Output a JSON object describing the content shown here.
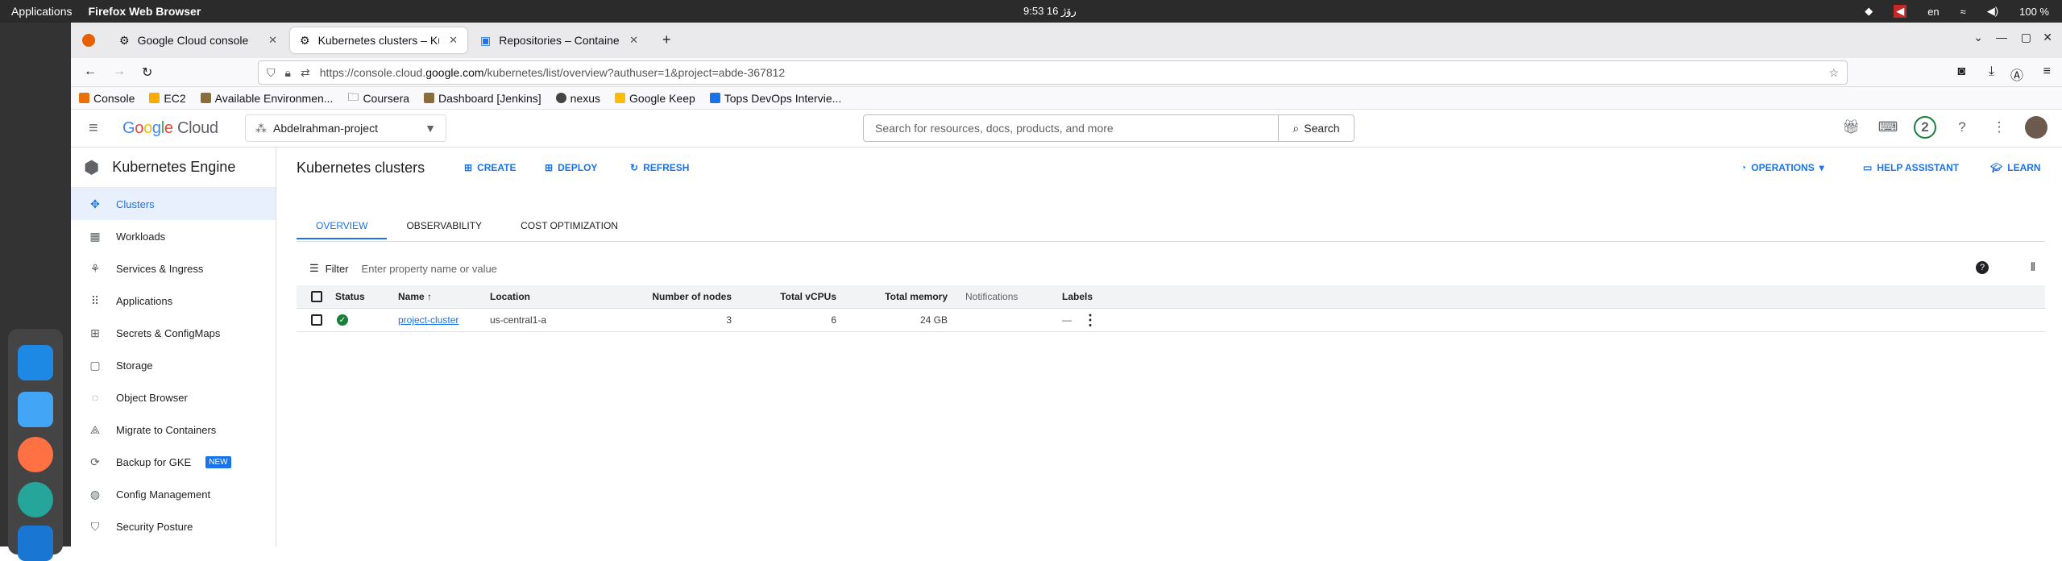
{
  "os": {
    "applications_label": "Applications",
    "window_title": "Firefox Web Browser",
    "clock": "9:53 رۆژ 16",
    "language": "en",
    "battery": "100 %"
  },
  "browser": {
    "tabs": [
      {
        "label": "Google Cloud console"
      },
      {
        "label": "Kubernetes clusters – Ku"
      },
      {
        "label": "Repositories – Container"
      }
    ],
    "url_prefix": "https://console.cloud.",
    "url_host": "google.com",
    "url_rest": "/kubernetes/list/overview?authuser=1&project=abde-367812",
    "bookmarks": [
      {
        "label": "Console",
        "color": "#e8710a"
      },
      {
        "label": "EC2",
        "color": "#f9ab00"
      },
      {
        "label": "Available Environmen...",
        "color": "#8a6d3b"
      },
      {
        "label": "Coursera",
        "color": "#777777"
      },
      {
        "label": "Dashboard [Jenkins]",
        "color": "#8a6d3b"
      },
      {
        "label": "nexus",
        "color": "#444444"
      },
      {
        "label": "Google Keep",
        "color": "#fbbc04"
      },
      {
        "label": "Tops DevOps Intervie...",
        "color": "#1a73e8"
      }
    ]
  },
  "gc": {
    "logo": "Google Cloud",
    "project": "Abdelrahman-project",
    "search_placeholder": "Search for resources, docs, products, and more",
    "search_button": "Search",
    "notification_count": "2"
  },
  "sidebar": {
    "title": "Kubernetes Engine",
    "items": [
      {
        "label": "Clusters",
        "icon": "clusters-icon"
      },
      {
        "label": "Workloads",
        "icon": "workloads-icon"
      },
      {
        "label": "Services & Ingress",
        "icon": "services-icon"
      },
      {
        "label": "Applications",
        "icon": "apps-icon"
      },
      {
        "label": "Secrets & ConfigMaps",
        "icon": "secrets-icon"
      },
      {
        "label": "Storage",
        "icon": "storage-icon"
      },
      {
        "label": "Object Browser",
        "icon": "object-browser-icon"
      },
      {
        "label": "Migrate to Containers",
        "icon": "migrate-icon"
      },
      {
        "label": "Backup for GKE",
        "icon": "backup-icon",
        "badge": "NEW"
      },
      {
        "label": "Config Management",
        "icon": "config-icon"
      },
      {
        "label": "Security Posture",
        "icon": "security-icon"
      }
    ]
  },
  "main": {
    "title": "Kubernetes clusters",
    "actions": {
      "create": "CREATE",
      "deploy": "DEPLOY",
      "refresh": "REFRESH",
      "operations": "OPERATIONS",
      "help": "HELP ASSISTANT",
      "learn": "LEARN"
    },
    "tabs": [
      "OVERVIEW",
      "OBSERVABILITY",
      "COST OPTIMIZATION"
    ],
    "filter_label": "Filter",
    "filter_placeholder": "Enter property name or value",
    "columns": [
      "Status",
      "Name",
      "Location",
      "Number of nodes",
      "Total vCPUs",
      "Total memory",
      "Notifications",
      "Labels"
    ],
    "rows": [
      {
        "name": "project-cluster",
        "location": "us-central1-a",
        "nodes": "3",
        "vcpus": "6",
        "memory": "24 GB",
        "notifications": "",
        "labels": "—"
      }
    ]
  }
}
